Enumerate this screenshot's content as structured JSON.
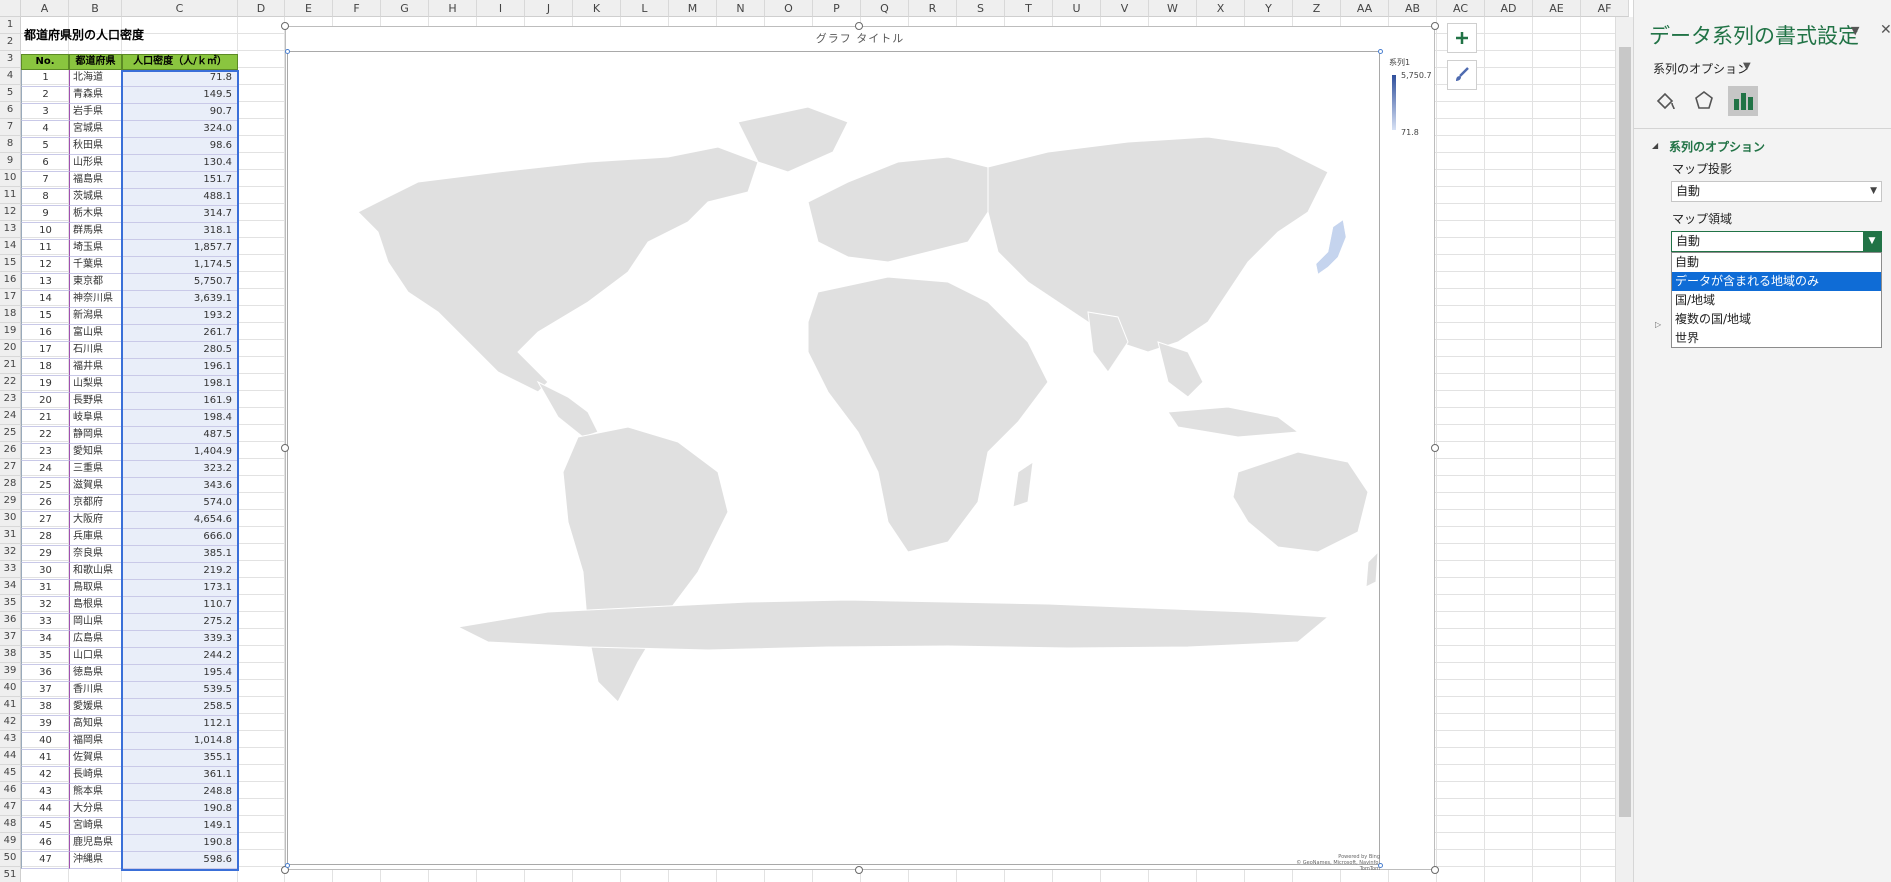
{
  "sheet": {
    "column_headers": [
      "A",
      "B",
      "C",
      "D",
      "E",
      "F",
      "G",
      "H",
      "I",
      "J",
      "K",
      "L",
      "M",
      "N",
      "O",
      "P",
      "Q",
      "R",
      "S",
      "T",
      "U",
      "V",
      "W",
      "X",
      "Y",
      "Z",
      "AA",
      "AB",
      "AC",
      "AD",
      "AE",
      "AF"
    ],
    "row_numbers": [
      "1",
      "2",
      "3",
      "4",
      "5",
      "6",
      "7",
      "8",
      "9",
      "10",
      "11",
      "12",
      "13",
      "14",
      "15",
      "16",
      "17",
      "18",
      "19",
      "20",
      "21",
      "22",
      "23",
      "24",
      "25",
      "26",
      "27",
      "28",
      "29",
      "30",
      "31",
      "32",
      "33",
      "34",
      "35",
      "36",
      "37",
      "38",
      "39",
      "40",
      "41",
      "42",
      "43",
      "44",
      "45",
      "46",
      "47",
      "48",
      "49",
      "50",
      "51"
    ],
    "title": "都道府県別の人口密度",
    "table": {
      "headers": [
        "No.",
        "都道府県",
        "人口密度（人/ｋ㎡）"
      ],
      "rows": [
        [
          "1",
          "北海道",
          "71.8"
        ],
        [
          "2",
          "青森県",
          "149.5"
        ],
        [
          "3",
          "岩手県",
          "90.7"
        ],
        [
          "4",
          "宮城県",
          "324.0"
        ],
        [
          "5",
          "秋田県",
          "98.6"
        ],
        [
          "6",
          "山形県",
          "130.4"
        ],
        [
          "7",
          "福島県",
          "151.7"
        ],
        [
          "8",
          "茨城県",
          "488.1"
        ],
        [
          "9",
          "栃木県",
          "314.7"
        ],
        [
          "10",
          "群馬県",
          "318.1"
        ],
        [
          "11",
          "埼玉県",
          "1,857.7"
        ],
        [
          "12",
          "千葉県",
          "1,174.5"
        ],
        [
          "13",
          "東京都",
          "5,750.7"
        ],
        [
          "14",
          "神奈川県",
          "3,639.1"
        ],
        [
          "15",
          "新潟県",
          "193.2"
        ],
        [
          "16",
          "富山県",
          "261.7"
        ],
        [
          "17",
          "石川県",
          "280.5"
        ],
        [
          "18",
          "福井県",
          "196.1"
        ],
        [
          "19",
          "山梨県",
          "198.1"
        ],
        [
          "20",
          "長野県",
          "161.9"
        ],
        [
          "21",
          "岐阜県",
          "198.4"
        ],
        [
          "22",
          "静岡県",
          "487.5"
        ],
        [
          "23",
          "愛知県",
          "1,404.9"
        ],
        [
          "24",
          "三重県",
          "323.2"
        ],
        [
          "25",
          "滋賀県",
          "343.6"
        ],
        [
          "26",
          "京都府",
          "574.0"
        ],
        [
          "27",
          "大阪府",
          "4,654.6"
        ],
        [
          "28",
          "兵庫県",
          "666.0"
        ],
        [
          "29",
          "奈良県",
          "385.1"
        ],
        [
          "30",
          "和歌山県",
          "219.2"
        ],
        [
          "31",
          "鳥取県",
          "173.1"
        ],
        [
          "32",
          "島根県",
          "110.7"
        ],
        [
          "33",
          "岡山県",
          "275.2"
        ],
        [
          "34",
          "広島県",
          "339.3"
        ],
        [
          "35",
          "山口県",
          "244.2"
        ],
        [
          "36",
          "徳島県",
          "195.4"
        ],
        [
          "37",
          "香川県",
          "539.5"
        ],
        [
          "38",
          "愛媛県",
          "258.5"
        ],
        [
          "39",
          "高知県",
          "112.1"
        ],
        [
          "40",
          "福岡県",
          "1,014.8"
        ],
        [
          "41",
          "佐賀県",
          "355.1"
        ],
        [
          "42",
          "長崎県",
          "361.1"
        ],
        [
          "43",
          "熊本県",
          "248.8"
        ],
        [
          "44",
          "大分県",
          "190.8"
        ],
        [
          "45",
          "宮崎県",
          "149.1"
        ],
        [
          "46",
          "鹿児島県",
          "190.8"
        ],
        [
          "47",
          "沖縄県",
          "598.6"
        ]
      ]
    }
  },
  "chart": {
    "title": "グラフ タイトル",
    "legend_title": "系列1",
    "legend_max": "5,750.7",
    "legend_min": "71.8",
    "attribution_line1": "Powered by Bing",
    "attribution_line2": "© GeoNames, Microsoft, Navinfo, TomTom",
    "land_color": "#e0e0e0",
    "highlight_color": "#c5d4ee"
  },
  "chart_buttons": [
    {
      "name": "chart-elements-button",
      "icon": "plus-icon"
    },
    {
      "name": "chart-styles-button",
      "icon": "brush-icon"
    }
  ],
  "panel": {
    "title": "データ系列の書式設定",
    "subtitle": "系列のオプション",
    "section": "系列のオプション",
    "projection_label": "マップ投影",
    "projection_value": "自動",
    "area_label": "マップ領域",
    "area_value": "自動",
    "area_options": [
      "自動",
      "データが含まれる地域のみ",
      "国/地域",
      "複数の国/地域",
      "世界"
    ],
    "highlighted_option": "データが含まれる地域のみ",
    "icons": [
      "fill-line-icon",
      "effects-icon",
      "series-options-icon"
    ]
  }
}
